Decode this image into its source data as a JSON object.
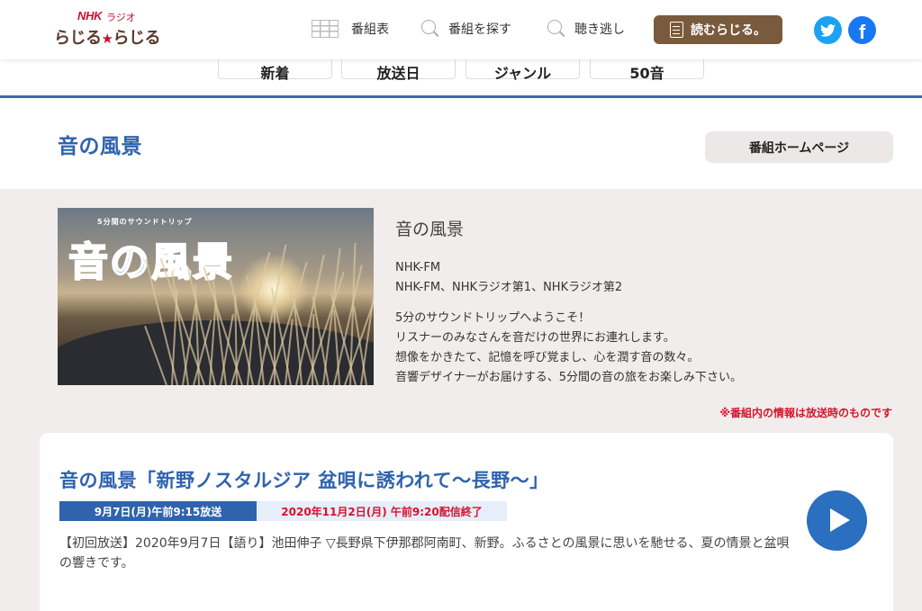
{
  "header": {
    "logo_nhk": "NHK",
    "logo_rajio": "ラジオ",
    "logo_part1": "らじる",
    "logo_star": "★",
    "logo_part2": "らじる",
    "nav": {
      "schedule": "番組表",
      "search": "番組を探す",
      "catchup": "聴き逃し"
    },
    "yomu_label": "読むらじる。"
  },
  "tabs": [
    "新着",
    "放送日",
    "ジャンル",
    "50音"
  ],
  "program": {
    "title": "音の風景",
    "homepage_label": "番組ホームページ",
    "image_tagline": "5分間のサウンドトリップ",
    "image_title": "音の風景",
    "info_title": "音の風景",
    "station": "NHK-FM",
    "stations_all": "NHK-FM、NHKラジオ第1、NHKラジオ第2",
    "desc_lines": [
      "5分のサウンドトリップへようこそ！",
      "リスナーのみなさんを音だけの世界にお連れします。",
      "想像をかきたて、記憶を呼び覚まし、心を潤す音の数々。",
      "音響デザイナーがお届けする、5分間の音の旅をお楽しみ下さい。"
    ],
    "notice": "※番組内の情報は放送時のものです"
  },
  "episode": {
    "title": "音の風景「新野ノスタルジア 盆唄に誘われて〜長野〜」",
    "air_badge": "9月7日(月)午前9:15放送",
    "end_badge": "2020年11月2日(月) 午前9:20配信終了",
    "description": "【初回放送】2020年9月7日【語り】池田伸子 ▽長野県下伊那郡阿南町、新野。ふるさとの風景に思いを馳せる、夏の情景と盆唄の響きです。"
  },
  "colors": {
    "accent_blue": "#2f63ad",
    "brand_brown": "#7a5a3c",
    "alert_red": "#d8122c",
    "twitter": "#1da1f2",
    "facebook": "#1877f2"
  },
  "icons": [
    "grid-icon",
    "search-icon",
    "document-icon",
    "twitter-icon",
    "facebook-icon",
    "play-icon"
  ]
}
